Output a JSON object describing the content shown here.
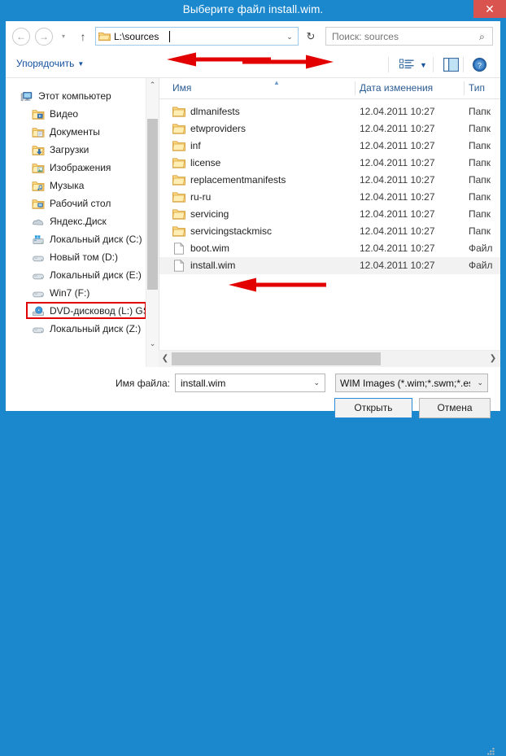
{
  "window": {
    "title": "Выберите файл install.wim.",
    "close_label": "✕",
    "frame_color": "#1b88ce",
    "close_color": "#d9534f"
  },
  "navbar": {
    "back_icon": "←",
    "forward_icon": "→",
    "recent_icon": "▾",
    "up_icon": "↑",
    "address_value": "L:\\sources",
    "address_dropdown_icon": "⌄",
    "refresh_icon": "↻",
    "search_placeholder": "Поиск: sources",
    "search_icon": "⌕"
  },
  "toolbar": {
    "organize_label": "Упорядочить",
    "organize_arrow": "▼",
    "view_arrow": "▼"
  },
  "sidebar": {
    "items": [
      {
        "label": "Этот компьютер",
        "level": 0,
        "icon": "computer-icon"
      },
      {
        "label": "Видео",
        "level": 1,
        "icon": "folder-video-icon"
      },
      {
        "label": "Документы",
        "level": 1,
        "icon": "folder-documents-icon"
      },
      {
        "label": "Загрузки",
        "level": 1,
        "icon": "folder-downloads-icon"
      },
      {
        "label": "Изображения",
        "level": 1,
        "icon": "folder-pictures-icon"
      },
      {
        "label": "Музыка",
        "level": 1,
        "icon": "folder-music-icon"
      },
      {
        "label": "Рабочий стол",
        "level": 1,
        "icon": "folder-desktop-icon"
      },
      {
        "label": "Яндекс.Диск",
        "level": 1,
        "icon": "yandex-disk-icon"
      },
      {
        "label": "Локальный диск (C:)",
        "level": 1,
        "icon": "system-drive-icon"
      },
      {
        "label": "Новый том (D:)",
        "level": 1,
        "icon": "drive-icon"
      },
      {
        "label": "Локальный диск (E:)",
        "level": 1,
        "icon": "drive-icon"
      },
      {
        "label": "Win7 (F:)",
        "level": 1,
        "icon": "drive-icon"
      },
      {
        "label": "DVD-дисковод (L:) GS",
        "level": 1,
        "icon": "dvd-drive-icon"
      },
      {
        "label": "Локальный диск (Z:)",
        "level": 1,
        "icon": "drive-icon"
      }
    ],
    "highlighted_index": 12,
    "highlight_color": "#e00000",
    "scroll_up_icon": "⌃",
    "scroll_down_icon": "⌄"
  },
  "filelist": {
    "columns": [
      {
        "key": "name",
        "label": "Имя"
      },
      {
        "key": "date",
        "label": "Дата изменения"
      },
      {
        "key": "type",
        "label": "Тип"
      }
    ],
    "sort_indicator": "▲",
    "rows": [
      {
        "name": "dlmanifests",
        "date": "12.04.2011 10:27",
        "type": "Папк",
        "icon": "folder-icon",
        "selected": false
      },
      {
        "name": "etwproviders",
        "date": "12.04.2011 10:27",
        "type": "Папк",
        "icon": "folder-icon",
        "selected": false
      },
      {
        "name": "inf",
        "date": "12.04.2011 10:27",
        "type": "Папк",
        "icon": "folder-icon",
        "selected": false
      },
      {
        "name": "license",
        "date": "12.04.2011 10:27",
        "type": "Папк",
        "icon": "folder-icon",
        "selected": false
      },
      {
        "name": "replacementmanifests",
        "date": "12.04.2011 10:27",
        "type": "Папк",
        "icon": "folder-icon",
        "selected": false
      },
      {
        "name": "ru-ru",
        "date": "12.04.2011 10:27",
        "type": "Папк",
        "icon": "folder-icon",
        "selected": false
      },
      {
        "name": "servicing",
        "date": "12.04.2011 10:27",
        "type": "Папк",
        "icon": "folder-icon",
        "selected": false
      },
      {
        "name": "servicingstackmisc",
        "date": "12.04.2011 10:27",
        "type": "Папк",
        "icon": "folder-icon",
        "selected": false
      },
      {
        "name": "boot.wim",
        "date": "12.04.2011 10:27",
        "type": "Файл",
        "icon": "file-icon",
        "selected": false
      },
      {
        "name": "install.wim",
        "date": "12.04.2011 10:27",
        "type": "Файл",
        "icon": "file-icon",
        "selected": true
      }
    ],
    "hscroll_left_icon": "❮",
    "hscroll_right_icon": "❯"
  },
  "footer": {
    "filename_label": "Имя файла:",
    "filename_value": "install.wim",
    "filename_dropdown_icon": "⌄",
    "filter_value": "WIM Images (*.wim;*.swm;*.esd",
    "filter_dropdown_icon": "⌄",
    "open_label": "Открыть",
    "cancel_label": "Отмена"
  },
  "annotations": {
    "arrow_color": "#e00000",
    "arrows": [
      {
        "name": "arrow-to-address-bar",
        "points_to": "address-bar"
      },
      {
        "name": "arrow-to-install-wim",
        "points_to": "install.wim row"
      },
      {
        "name": "arrow-to-open-button",
        "points_to": "Открыть button"
      }
    ]
  }
}
